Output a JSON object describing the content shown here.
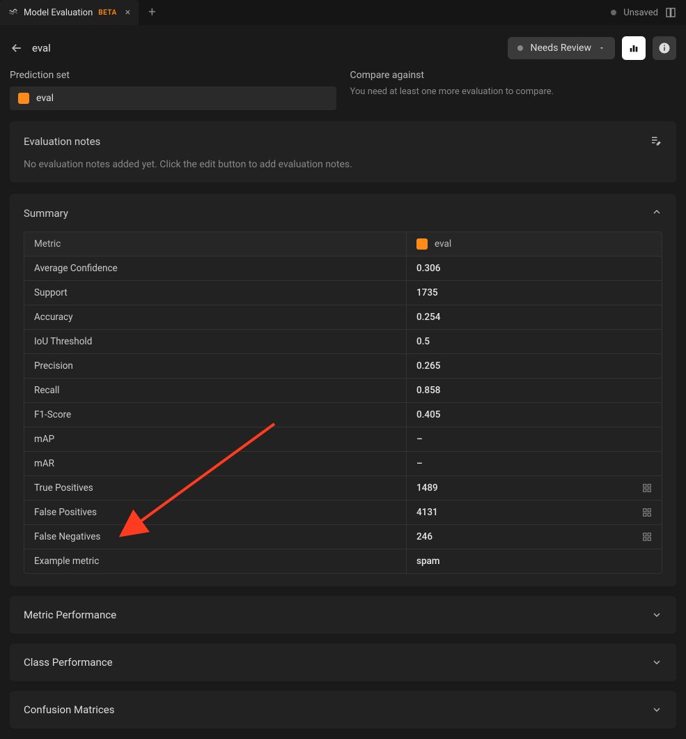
{
  "tab": {
    "icon": "eval-icon",
    "title": "Model Evaluation",
    "badge": "BETA"
  },
  "topbar": {
    "unsaved": "Unsaved"
  },
  "header": {
    "title": "eval",
    "status": "Needs Review"
  },
  "prediction": {
    "label": "Prediction set",
    "value": "eval"
  },
  "compare": {
    "label": "Compare against",
    "hint": "You need at least one more evaluation to compare."
  },
  "notes": {
    "title": "Evaluation notes",
    "empty": "No evaluation notes added yet. Click the edit button to add evaluation notes."
  },
  "summary": {
    "title": "Summary",
    "col_metric": "Metric",
    "col_eval": "eval",
    "rows": [
      {
        "metric": "Average Confidence",
        "value": "0.306",
        "grid": false
      },
      {
        "metric": "Support",
        "value": "1735",
        "grid": false
      },
      {
        "metric": "Accuracy",
        "value": "0.254",
        "grid": false
      },
      {
        "metric": "IoU Threshold",
        "value": "0.5",
        "grid": false
      },
      {
        "metric": "Precision",
        "value": "0.265",
        "grid": false
      },
      {
        "metric": "Recall",
        "value": "0.858",
        "grid": false
      },
      {
        "metric": "F1-Score",
        "value": "0.405",
        "grid": false
      },
      {
        "metric": "mAP",
        "value": "–",
        "grid": false
      },
      {
        "metric": "mAR",
        "value": "–",
        "grid": false
      },
      {
        "metric": "True Positives",
        "value": "1489",
        "grid": true
      },
      {
        "metric": "False Positives",
        "value": "4131",
        "grid": true
      },
      {
        "metric": "False Negatives",
        "value": "246",
        "grid": true
      },
      {
        "metric": "Example metric",
        "value": "spam",
        "grid": false
      }
    ]
  },
  "sections": {
    "metric_perf": "Metric Performance",
    "class_perf": "Class Performance",
    "confusion": "Confusion Matrices"
  }
}
